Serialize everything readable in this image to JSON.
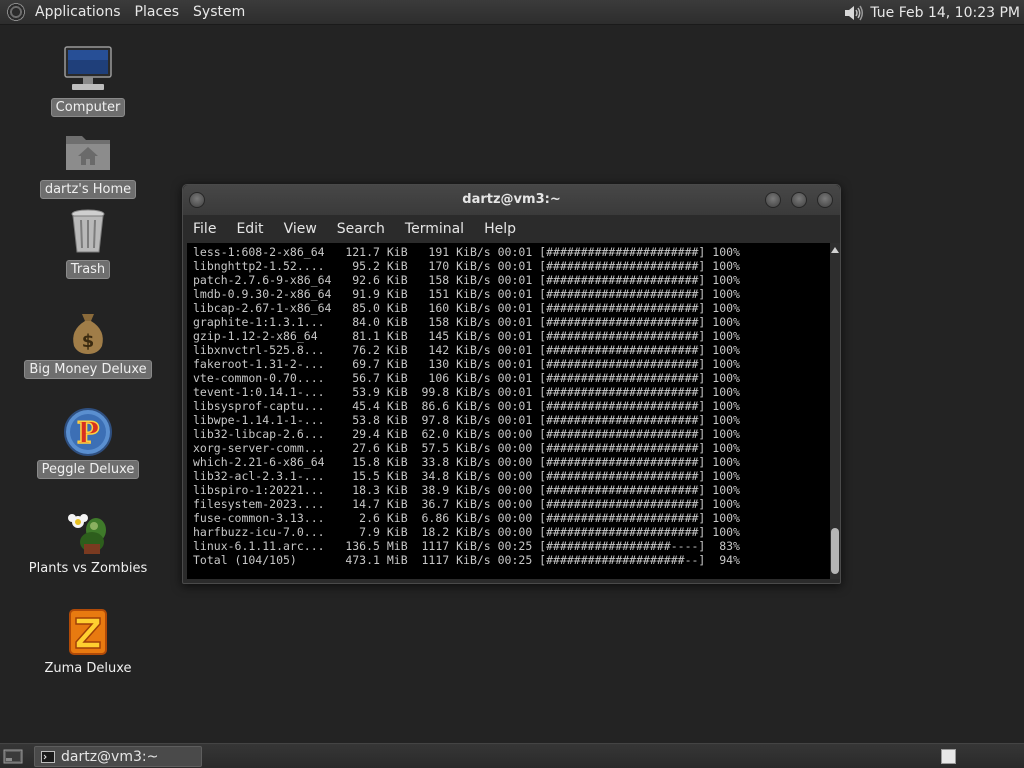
{
  "top_panel": {
    "menus": [
      "Applications",
      "Places",
      "System"
    ],
    "clock": "Tue Feb 14, 10:23 PM",
    "icons": {
      "distro": "distro-logo-icon",
      "volume": "speaker-icon"
    }
  },
  "desktop_icons": [
    {
      "label": "Computer",
      "icon": "computer-icon"
    },
    {
      "label": "dartz's Home",
      "icon": "home-folder-icon"
    },
    {
      "label": "Trash",
      "icon": "trash-icon"
    },
    {
      "label": "Big Money Deluxe",
      "icon": "money-bag-icon"
    },
    {
      "label": "Peggle Deluxe",
      "icon": "peggle-icon"
    },
    {
      "label": "Plants vs Zombies",
      "icon": "plants-vs-zombies-icon"
    },
    {
      "label": "Zuma Deluxe",
      "icon": "zuma-icon"
    }
  ],
  "terminal": {
    "title": "dartz@vm3:~",
    "menu": [
      "File",
      "Edit",
      "View",
      "Search",
      "Terminal",
      "Help"
    ],
    "lines": [
      "less-1:608-2-x86_64   121.7 KiB   191 KiB/s 00:01 [######################] 100%",
      "libnghttp2-1.52....    95.2 KiB   170 KiB/s 00:01 [######################] 100%",
      "patch-2.7.6-9-x86_64   92.6 KiB   158 KiB/s 00:01 [######################] 100%",
      "lmdb-0.9.30-2-x86_64   91.9 KiB   151 KiB/s 00:01 [######################] 100%",
      "libcap-2.67-1-x86_64   85.0 KiB   160 KiB/s 00:01 [######################] 100%",
      "graphite-1:1.3.1...    84.0 KiB   158 KiB/s 00:01 [######################] 100%",
      "gzip-1.12-2-x86_64     81.1 KiB   145 KiB/s 00:01 [######################] 100%",
      "libxnvctrl-525.8...    76.2 KiB   142 KiB/s 00:01 [######################] 100%",
      "fakeroot-1.31-2-...    69.7 KiB   130 KiB/s 00:01 [######################] 100%",
      "vte-common-0.70....    56.7 KiB   106 KiB/s 00:01 [######################] 100%",
      "tevent-1:0.14.1-...    53.9 KiB  99.8 KiB/s 00:01 [######################] 100%",
      "libsysprof-captu...    45.4 KiB  86.6 KiB/s 00:01 [######################] 100%",
      "libwpe-1.14.1-1-...    53.8 KiB  97.8 KiB/s 00:01 [######################] 100%",
      "lib32-libcap-2.6...    29.4 KiB  62.0 KiB/s 00:00 [######################] 100%",
      "xorg-server-comm...    27.6 KiB  57.5 KiB/s 00:00 [######################] 100%",
      "which-2.21-6-x86_64    15.8 KiB  33.8 KiB/s 00:00 [######################] 100%",
      "lib32-acl-2.3.1-...    15.5 KiB  34.8 KiB/s 00:00 [######################] 100%",
      "libspiro-1:20221...    18.3 KiB  38.9 KiB/s 00:00 [######################] 100%",
      "filesystem-2023....    14.7 KiB  36.7 KiB/s 00:00 [######################] 100%",
      "fuse-common-3.13...     2.6 KiB  6.86 KiB/s 00:00 [######################] 100%",
      "harfbuzz-icu-7.0...     7.9 KiB  18.2 KiB/s 00:00 [######################] 100%",
      "linux-6.1.11.arc...   136.5 MiB  1117 KiB/s 00:25 [##################----]  83%",
      "Total (104/105)       473.1 MiB  1117 KiB/s 00:25 [####################--]  94%"
    ]
  },
  "taskbar": {
    "task_label": "dartz@vm3:~",
    "icons": {
      "show_desktop": "show-desktop-icon",
      "task": "terminal-icon",
      "workspace": "workspace-switcher-icon"
    }
  }
}
